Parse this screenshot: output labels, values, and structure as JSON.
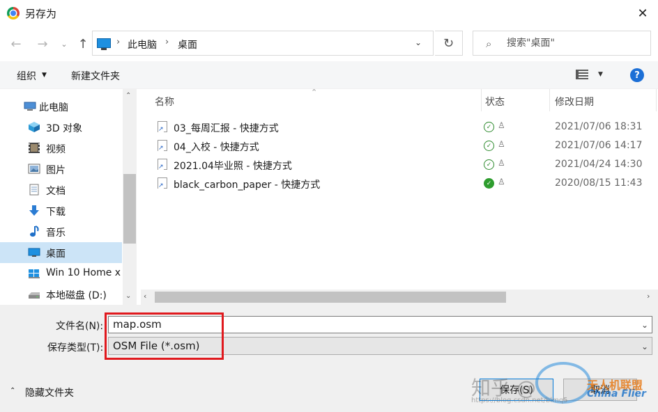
{
  "window": {
    "title": "另存为",
    "close_glyph": "✕"
  },
  "nav": {
    "back": "←",
    "forward": "→",
    "recent": "⌄",
    "up": "↑",
    "refresh": "↻"
  },
  "address": {
    "sep": "›",
    "crumbs": [
      "此电脑",
      "桌面"
    ],
    "dropdown": "⌄"
  },
  "search": {
    "placeholder": "搜索\"桌面\"",
    "icon": "⌕"
  },
  "toolbar": {
    "organize": "组织",
    "organize_caret": "▼",
    "new_folder": "新建文件夹",
    "view_caret": "▼",
    "help": "?"
  },
  "sidebar": {
    "items": [
      {
        "label": "此电脑",
        "icon": "pc-icon"
      },
      {
        "label": "3D 对象",
        "icon": "cube-icon"
      },
      {
        "label": "视频",
        "icon": "video-icon"
      },
      {
        "label": "图片",
        "icon": "picture-icon"
      },
      {
        "label": "文档",
        "icon": "document-icon"
      },
      {
        "label": "下载",
        "icon": "download-icon"
      },
      {
        "label": "音乐",
        "icon": "music-icon"
      },
      {
        "label": "桌面",
        "icon": "desktop-icon",
        "selected": true
      },
      {
        "label": "Win 10 Home x",
        "icon": "windows-drive-icon"
      },
      {
        "label": "本地磁盘 (D:)",
        "icon": "disk-icon"
      }
    ],
    "scroll_up": "⌃",
    "scroll_down": "⌄"
  },
  "columns": {
    "name": "名称",
    "status": "状态",
    "date": "修改日期",
    "sort_caret": "⌃"
  },
  "files": [
    {
      "name": "03_每周汇报 - 快捷方式",
      "status": "✓",
      "date": "2021/07/06 18:31"
    },
    {
      "name": "04_入校 - 快捷方式",
      "status": "✓",
      "date": "2021/07/06 14:17"
    },
    {
      "name": "2021.04毕业照 - 快捷方式",
      "status": "✓",
      "date": "2021/04/24 14:30"
    },
    {
      "name": "black_carbon_paper - 快捷方式",
      "status": "✓",
      "date": "2020/08/15 11:43"
    }
  ],
  "user_glyph": "♙",
  "hscroll": {
    "left": "‹",
    "right": "›"
  },
  "form": {
    "filename_label": "文件名(N):",
    "filename_value": "map.osm",
    "filetype_label": "保存类型(T):",
    "filetype_value": "OSM File (*.osm)",
    "dropdown": "⌄"
  },
  "footer": {
    "hide_caret": "⌃",
    "hide_folders": "隐藏文件夹",
    "save": "保存(S)",
    "cancel": "取消"
  },
  "watermark": {
    "zhihu": "知乎 @",
    "cn": "无人机联盟",
    "en": "China Flier",
    "url": "https://blog.csdn.net/blmq5"
  },
  "colors": {
    "accent": "#0078d7",
    "selected": "#cce4f7",
    "highlight": "#e0191e"
  }
}
